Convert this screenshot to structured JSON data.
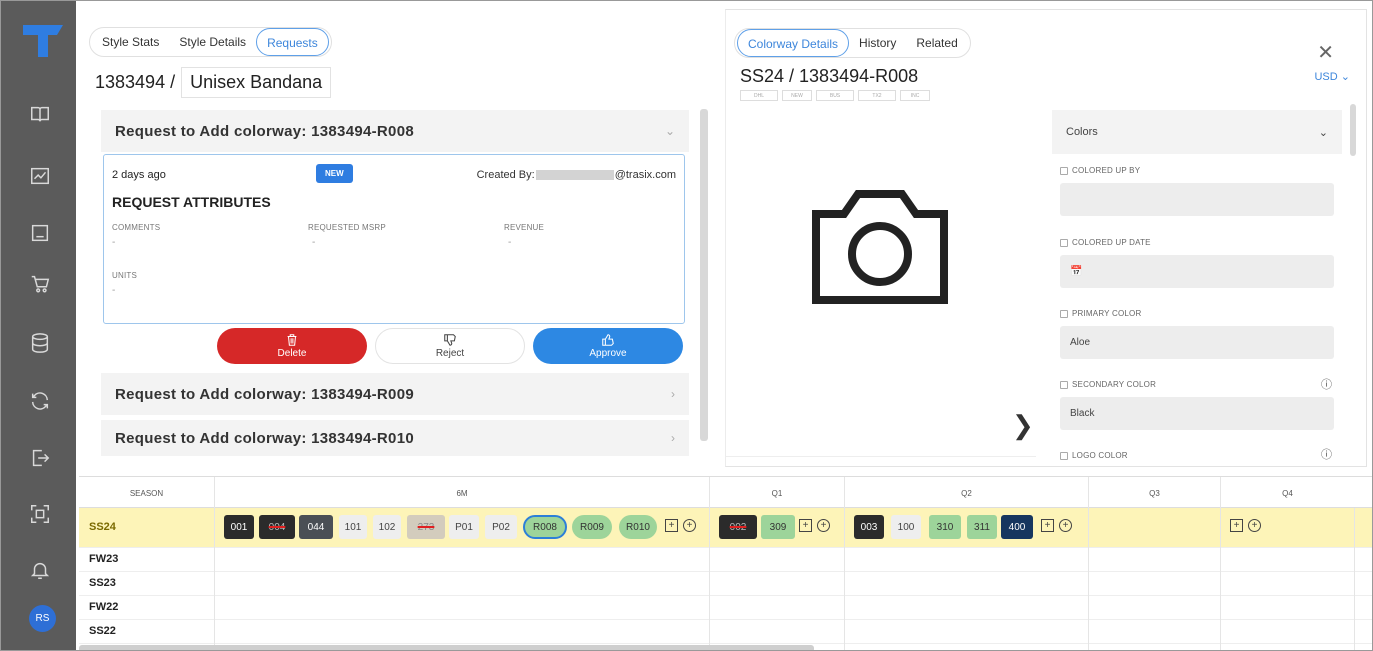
{
  "left_panel": {
    "tabs": [
      "Style Stats",
      "Style Details",
      "Requests"
    ],
    "style_number": "1383494 /",
    "style_name": "Unisex Bandana",
    "requests": [
      {
        "title": "Request to Add colorway: 1383494-R008"
      },
      {
        "title": "Request to Add colorway: 1383494-R009"
      },
      {
        "title": "Request to Add colorway: 1383494-R010"
      }
    ],
    "card": {
      "ago": "2 days ago",
      "badge": "NEW",
      "created_by_label": "Created By:",
      "created_by_domain": "@trasix.com",
      "attributes_title": "REQUEST ATTRIBUTES",
      "comments_label": "COMMENTS",
      "comments_value": "-",
      "msrp_label": "REQUESTED MSRP",
      "msrp_value": "-",
      "revenue_label": "REVENUE",
      "revenue_value": "-",
      "units_label": "UNITS",
      "units_value": "-"
    },
    "actions": {
      "delete": "Delete",
      "reject": "Reject",
      "approve": "Approve"
    }
  },
  "right_panel": {
    "tabs": [
      "Colorway Details",
      "History",
      "Related"
    ],
    "colorway_title": "SS24 / 1383494-R008",
    "chips": [
      "DHL",
      "NEW",
      "BUS",
      "TX2",
      "INC"
    ],
    "currency": "USD",
    "colors_section": {
      "header": "Colors",
      "fields": [
        {
          "label": "COLORED UP BY",
          "value": ""
        },
        {
          "label": "COLORED UP DATE",
          "value": ""
        },
        {
          "label": "PRIMARY COLOR",
          "value": "Aloe"
        },
        {
          "label": "SECONDARY COLOR",
          "value": "Black"
        },
        {
          "label": "LOGO COLOR",
          "value": ""
        }
      ]
    }
  },
  "grid": {
    "headers": [
      "SEASON",
      "6M",
      "Q1",
      "Q2",
      "Q3",
      "Q4"
    ],
    "seasons": [
      "SS24",
      "FW23",
      "SS23",
      "FW22",
      "SS22"
    ],
    "ss24": {
      "m6": [
        "001",
        "004",
        "044",
        "101",
        "102",
        "273",
        "P01",
        "P02",
        "R008",
        "R009",
        "R010"
      ],
      "q1": [
        "002",
        "309"
      ],
      "q2": [
        "003",
        "100",
        "310",
        "311",
        "400"
      ]
    }
  },
  "user": {
    "initials": "RS"
  },
  "colors": {
    "accent": "#2d88e3",
    "danger": "#d62828",
    "highlight": "#fdf4b8",
    "rail": "#5b5b5b"
  }
}
